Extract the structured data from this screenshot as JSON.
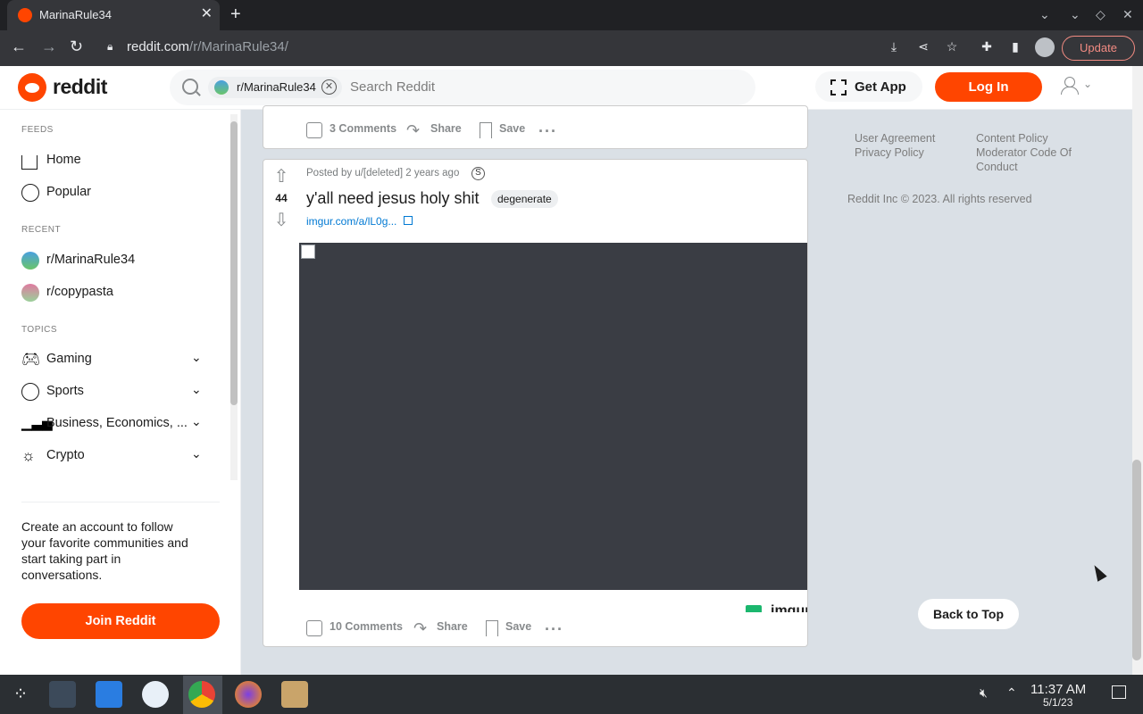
{
  "browser": {
    "tab_title": "MarinaRule34",
    "url_host": "reddit.com",
    "url_path": "/r/MarinaRule34/",
    "update_label": "Update"
  },
  "header": {
    "wordmark": "reddit",
    "search_chip": "r/MarinaRule34",
    "search_placeholder": "Search Reddit",
    "get_app": "Get App",
    "login": "Log In"
  },
  "sidebar": {
    "feeds_heading": "FEEDS",
    "feeds": [
      {
        "label": "Home",
        "icon": "home-icon"
      },
      {
        "label": "Popular",
        "icon": "popular-icon"
      }
    ],
    "recent_heading": "RECENT",
    "recent": [
      {
        "label": "r/MarinaRule34",
        "icon": "subreddit-icon"
      },
      {
        "label": "r/copypasta",
        "icon": "subreddit-icon"
      }
    ],
    "topics_heading": "TOPICS",
    "topics": [
      {
        "label": "Gaming",
        "icon": "gamepad-icon"
      },
      {
        "label": "Sports",
        "icon": "sports-icon"
      },
      {
        "label": "Business, Economics, ...",
        "icon": "chart-icon"
      },
      {
        "label": "Crypto",
        "icon": "crypto-icon"
      }
    ],
    "cta": "Create an account to follow your favorite communities and start taking part in conversations.",
    "join": "Join Reddit"
  },
  "post_prev": {
    "comments": "3 Comments",
    "share": "Share",
    "save": "Save"
  },
  "post": {
    "score": "44",
    "posted_by": "Posted by u/[deleted] 2 years ago",
    "title": "y'all need jesus holy shit",
    "flair": "degenerate",
    "link": "imgur.com/a/lL0g...",
    "comments": "10 Comments",
    "share": "Share",
    "save": "Save",
    "source_mark": "imgur"
  },
  "right": {
    "links": [
      "User Agreement",
      "Privacy Policy",
      "Content Policy",
      "Moderator Code Of Conduct"
    ],
    "copyright": "Reddit Inc © 2023. All rights reserved",
    "back_to_top": "Back to Top"
  },
  "taskbar": {
    "time": "11:37 AM",
    "date": "5/1/23"
  },
  "colors": {
    "brand": "#ff4500",
    "link": "#0079d3",
    "page_bg": "#dae0e6"
  }
}
